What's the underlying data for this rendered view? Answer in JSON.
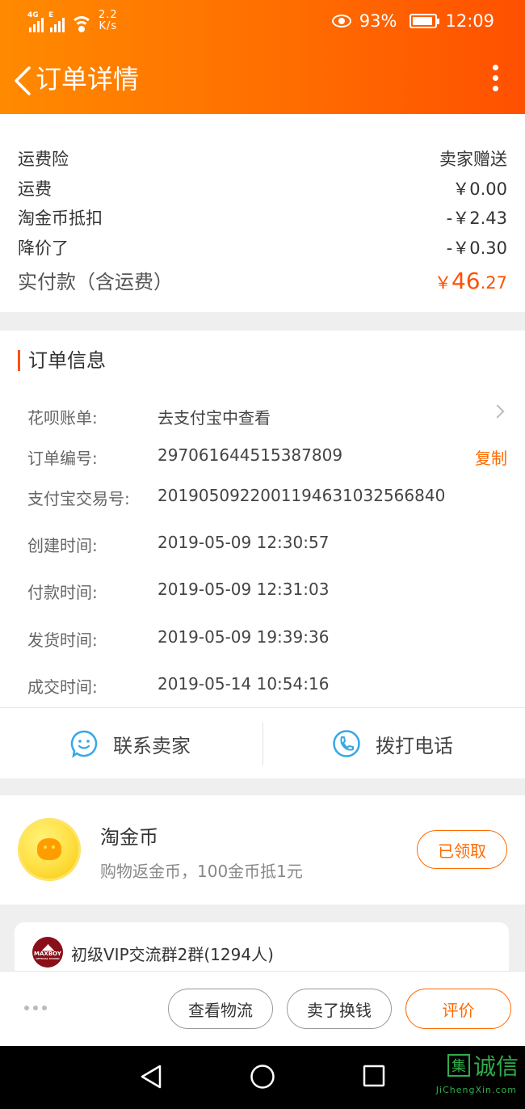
{
  "status_bar": {
    "net1": "4G",
    "net2": "E",
    "speed_value": "2.2",
    "speed_unit": "K/s",
    "battery": "93%",
    "time": "12:09"
  },
  "header": {
    "title": "订单详情"
  },
  "price": {
    "rows": [
      {
        "label": "运费险",
        "value": "卖家赠送"
      },
      {
        "label": "运费",
        "value": "￥0.00"
      },
      {
        "label": "淘金币抵扣",
        "value": "-￥2.43"
      },
      {
        "label": "降价了",
        "value": "-￥0.30"
      }
    ],
    "total_label": "实付款（含运费）",
    "total_currency": "￥",
    "total_int": "46",
    "total_dec": ".27"
  },
  "order_info": {
    "title": "订单信息",
    "rows": [
      {
        "label": "花呗账单:",
        "value": "去支付宝中查看"
      },
      {
        "label": "订单编号:",
        "value": "297061644515387809",
        "action": "复制"
      },
      {
        "label": "支付宝交易号:",
        "value": "2019050922001194631032566840"
      },
      {
        "label": "创建时间:",
        "value": "2019-05-09 12:30:57"
      },
      {
        "label": "付款时间:",
        "value": "2019-05-09 12:31:03"
      },
      {
        "label": "发货时间:",
        "value": "2019-05-09 19:39:36"
      },
      {
        "label": "成交时间:",
        "value": "2019-05-14 10:54:16"
      }
    ]
  },
  "contact": {
    "seller": "联系卖家",
    "phone": "拨打电话"
  },
  "coin": {
    "title": "淘金币",
    "subtitle": "购物返金币，100金币抵1元",
    "button": "已领取"
  },
  "group": {
    "avatar_brand": "MAXBOY",
    "avatar_sub": "OFFICIAL STUDIO",
    "name": "初级VIP交流群2群(1294人)"
  },
  "actions": {
    "logistics": "查看物流",
    "resell": "卖了换钱",
    "review": "评价"
  },
  "watermark": {
    "box": "集",
    "text": "诚信",
    "url": "JiChengXin.com"
  },
  "colors": {
    "accent": "#ff5000",
    "header_start": "#ff8a00",
    "header_end": "#ff5000"
  }
}
